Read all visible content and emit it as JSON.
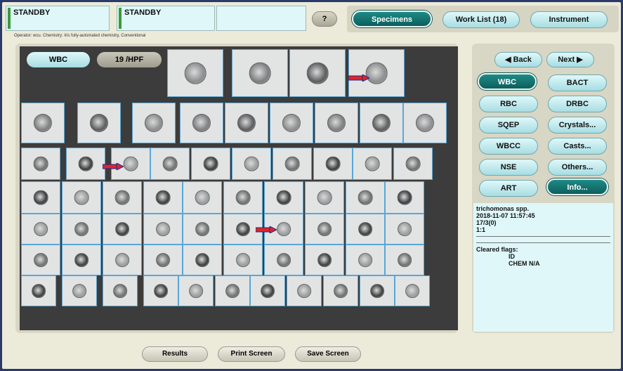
{
  "status": {
    "box1": "STANDBY",
    "box2": "STANDBY",
    "box3": ""
  },
  "help_label": "?",
  "nav": {
    "specimens": "Specimens",
    "worklist": "Work List (18)",
    "instrument": "Instrument"
  },
  "operator_line": "Operator: wcu.   Chemistry: Iris fully-automated chemistry, Conventional",
  "image_panel": {
    "category_tab": "WBC",
    "count_tab": "19 /HPF"
  },
  "right": {
    "back": "Back",
    "next": "Next",
    "buttons": [
      "WBC",
      "BACT",
      "RBC",
      "DRBC",
      "SQEP",
      "Crystals...",
      "WBCC",
      "Casts...",
      "NSE",
      "Others...",
      "ART",
      "Info..."
    ]
  },
  "info": {
    "line1": "trichomonas spp.",
    "line2": "2018-11-07 11:57:45",
    "line3": "17/3(0)",
    "line4": "1:1",
    "cleared_title": "Cleared flags:",
    "flag1": "ID",
    "flag2": "CHEM N/A"
  },
  "bottom": {
    "results": "Results",
    "print": "Print Screen",
    "save": "Save Screen"
  },
  "colors": {
    "accent": "#0d5f5c",
    "panel": "#dff7f9",
    "arrow": "#e0242a"
  }
}
